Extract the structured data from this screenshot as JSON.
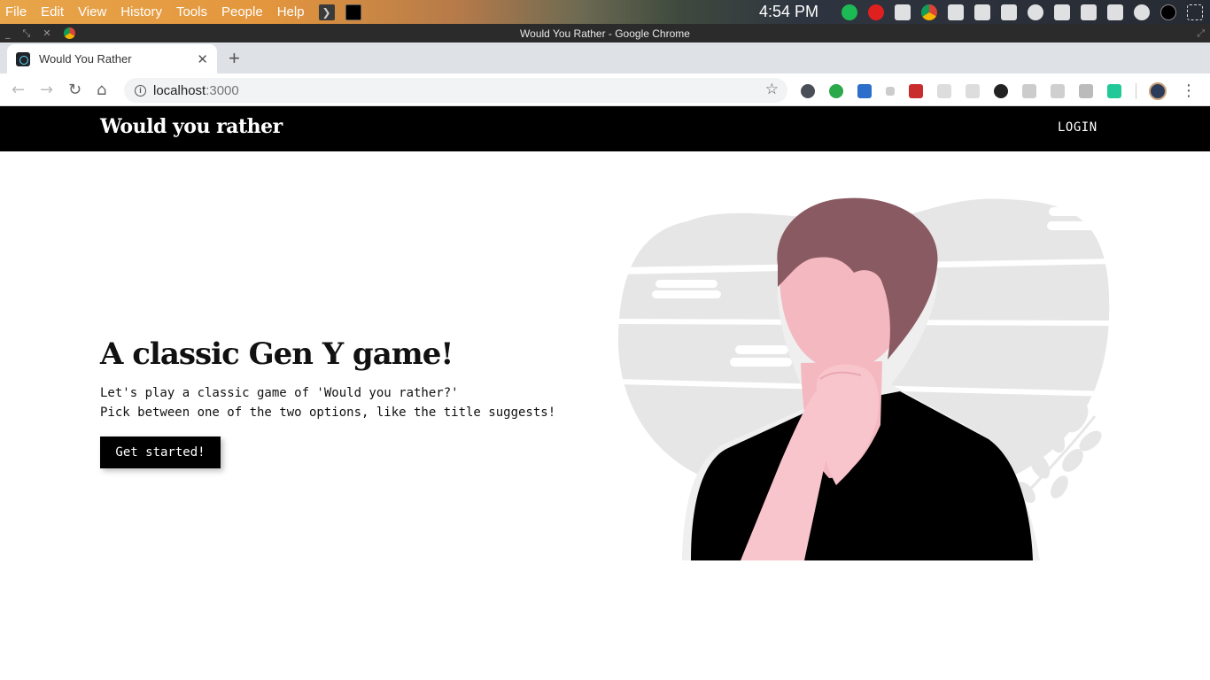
{
  "os": {
    "menu": [
      "File",
      "Edit",
      "View",
      "History",
      "Tools",
      "People",
      "Help"
    ],
    "clock": "4:54 PM"
  },
  "window": {
    "title": "Would You Rather - Google Chrome"
  },
  "browser": {
    "tab_title": "Would You Rather",
    "url_host": "localhost",
    "url_port": ":3000"
  },
  "site": {
    "brand": "Would you rather",
    "login_label": "LOGIN",
    "hero_title": "A classic Gen Y game!",
    "hero_line_1": "Let's play a classic game of 'Would you rather?'",
    "hero_line_2": "Pick between one of the two options, like the title suggests!",
    "cta_label": "Get started!"
  },
  "icons": {
    "back": "arrow-left-icon",
    "forward": "arrow-right-icon",
    "reload": "reload-icon",
    "home": "home-icon",
    "bookmark": "star-icon",
    "menu": "kebab-menu-icon"
  },
  "colors": {
    "navbar": "#000000",
    "button": "#000000",
    "hair": "#8a5a62",
    "skin": "#f4b9c0",
    "background_blob": "#e6e6e6"
  }
}
